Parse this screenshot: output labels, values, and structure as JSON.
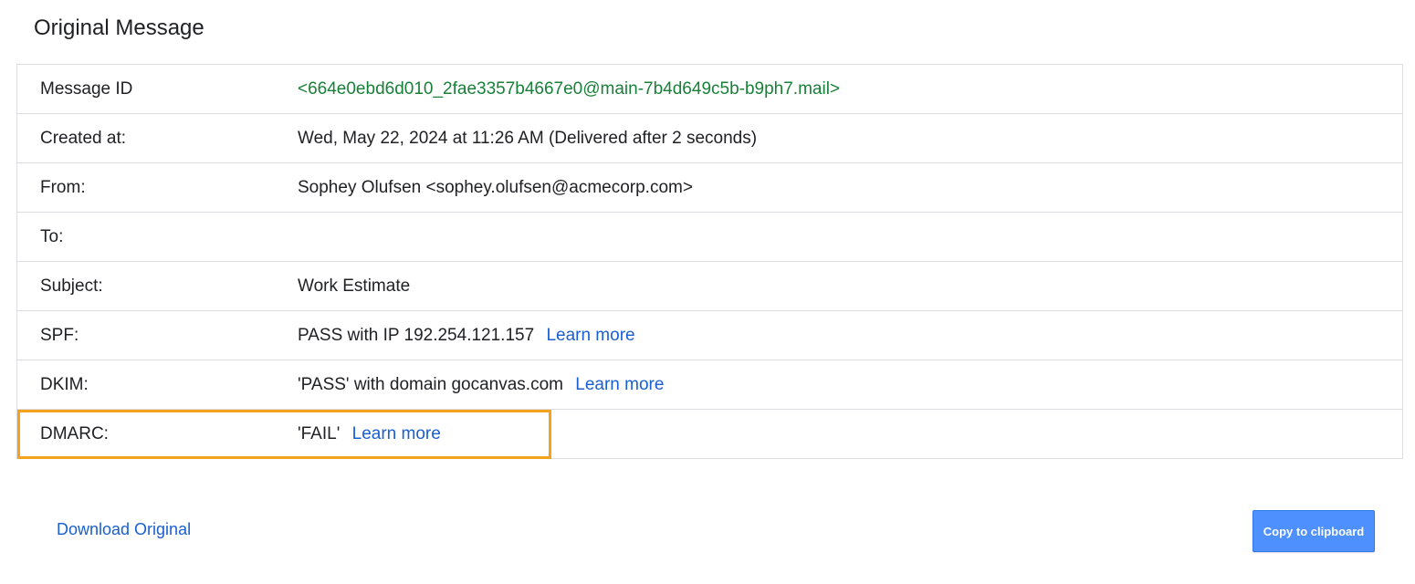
{
  "page": {
    "title": "Original Message"
  },
  "details": {
    "message_id": {
      "label": "Message ID",
      "value": "<664e0ebd6d010_2fae3357b4667e0@main-7b4d649c5b-b9ph7.mail>"
    },
    "created_at": {
      "label": "Created at:",
      "value": "Wed, May 22, 2024 at 11:26 AM (Delivered after 2 seconds)"
    },
    "from": {
      "label": "From:",
      "value": "Sophey Olufsen <sophey.olufsen@acmecorp.com>"
    },
    "to": {
      "label": "To:",
      "value": ""
    },
    "subject": {
      "label": "Subject:",
      "value": "Work Estimate"
    },
    "spf": {
      "label": "SPF:",
      "value": "PASS with IP 192.254.121.157",
      "link": "Learn more"
    },
    "dkim": {
      "label": "DKIM:",
      "value": "'PASS' with domain gocanvas.com",
      "link": "Learn more"
    },
    "dmarc": {
      "label": "DMARC:",
      "value": "'FAIL'",
      "link": "Learn more"
    }
  },
  "footer": {
    "download_label": "Download Original",
    "copy_label": "Copy to clipboard"
  },
  "colors": {
    "message_id_text": "#188038",
    "link": "#1a5fd1",
    "highlight_border": "#f4a21b",
    "button_bg": "#4d90fe"
  }
}
